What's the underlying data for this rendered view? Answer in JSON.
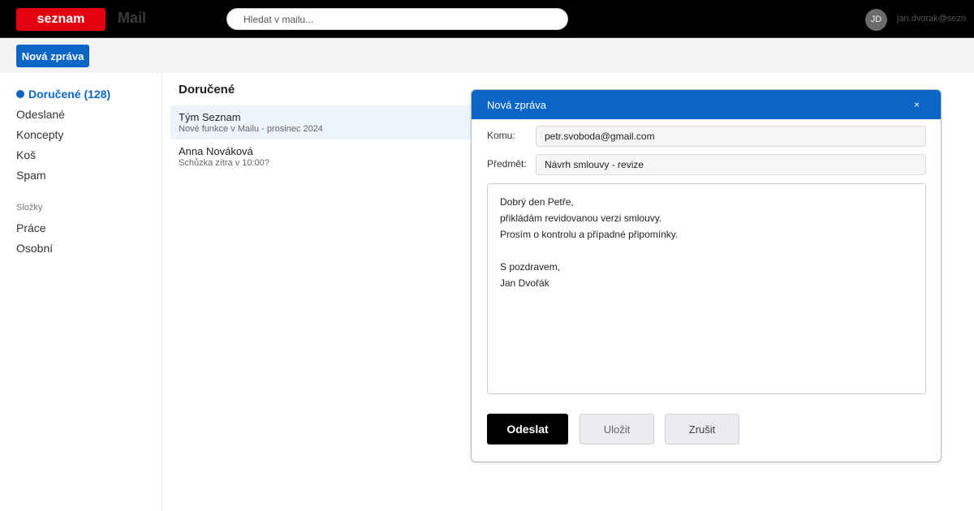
{
  "header": {
    "logo": "seznam",
    "app_name": "Mail",
    "search_placeholder": "Hledat v mailu...",
    "avatar_initials": "JD",
    "user_email": "jan.dvorak@sezn"
  },
  "toolbar": {
    "compose_label": "Nová zpráva"
  },
  "sidebar": {
    "items": [
      {
        "label": "Doručené (128)"
      },
      {
        "label": "Odeslané"
      },
      {
        "label": "Koncepty"
      },
      {
        "label": "Koš"
      },
      {
        "label": "Spam"
      }
    ],
    "folders_heading": "Složky",
    "folders": [
      {
        "label": "Práce"
      },
      {
        "label": "Osobní"
      }
    ]
  },
  "mail_list": {
    "title": "Doručené",
    "rows": [
      {
        "sender": "Tým Seznam",
        "preview": "Nové funkce v Mailu - prosinec 2024"
      },
      {
        "sender": "Anna Nováková",
        "preview": "Schůzka zítra v 10:00?"
      }
    ]
  },
  "compose": {
    "title": "Nová zpráva",
    "close_label": "×",
    "to_label": "Komu:",
    "to_value": "petr.svoboda@gmail.com",
    "subject_label": "Předmět:",
    "subject_value": "Návrh smlouvy - revize",
    "body": "Dobrý den Petře,\npřikládám revidovanou verzi smlouvy.\nProsím o kontrolu a případné připomínky.\n\nS pozdravem,\nJan Dvořák",
    "send_label": "Odeslat",
    "save_label": "Uložit",
    "cancel_label": "Zrušit"
  },
  "colors": {
    "brand_red": "#e3000f",
    "accent_blue": "#0b66c8",
    "topbar": "#000000"
  }
}
